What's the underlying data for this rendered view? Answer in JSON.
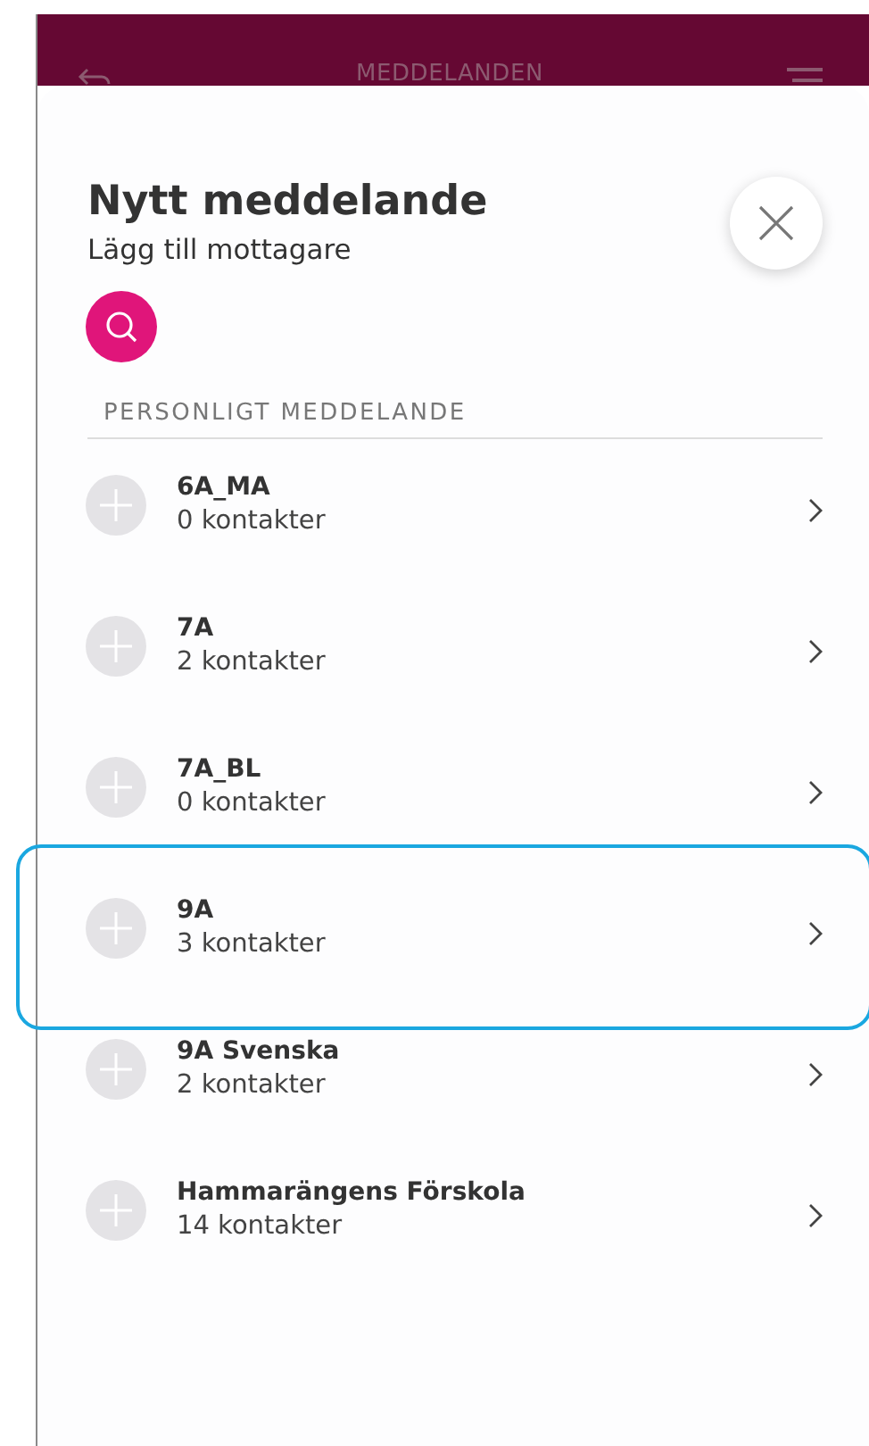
{
  "header": {
    "title": "MEDDELANDEN"
  },
  "sheet": {
    "title": "Nytt meddelande",
    "subtitle": "Lägg till mottagare",
    "section_label": "PERSONLIGT MEDDELANDE"
  },
  "rows": [
    {
      "name": "6A_MA",
      "count": "0 kontakter",
      "selected": false
    },
    {
      "name": "7A",
      "count": "2 kontakter",
      "selected": false
    },
    {
      "name": "7A_BL",
      "count": "0 kontakter",
      "selected": false
    },
    {
      "name": "9A",
      "count": "3 kontakter",
      "selected": true
    },
    {
      "name": "9A Svenska",
      "count": "2 kontakter",
      "selected": false
    },
    {
      "name": "Hammarängens Förskola",
      "count": "14 kontakter",
      "selected": false
    }
  ]
}
